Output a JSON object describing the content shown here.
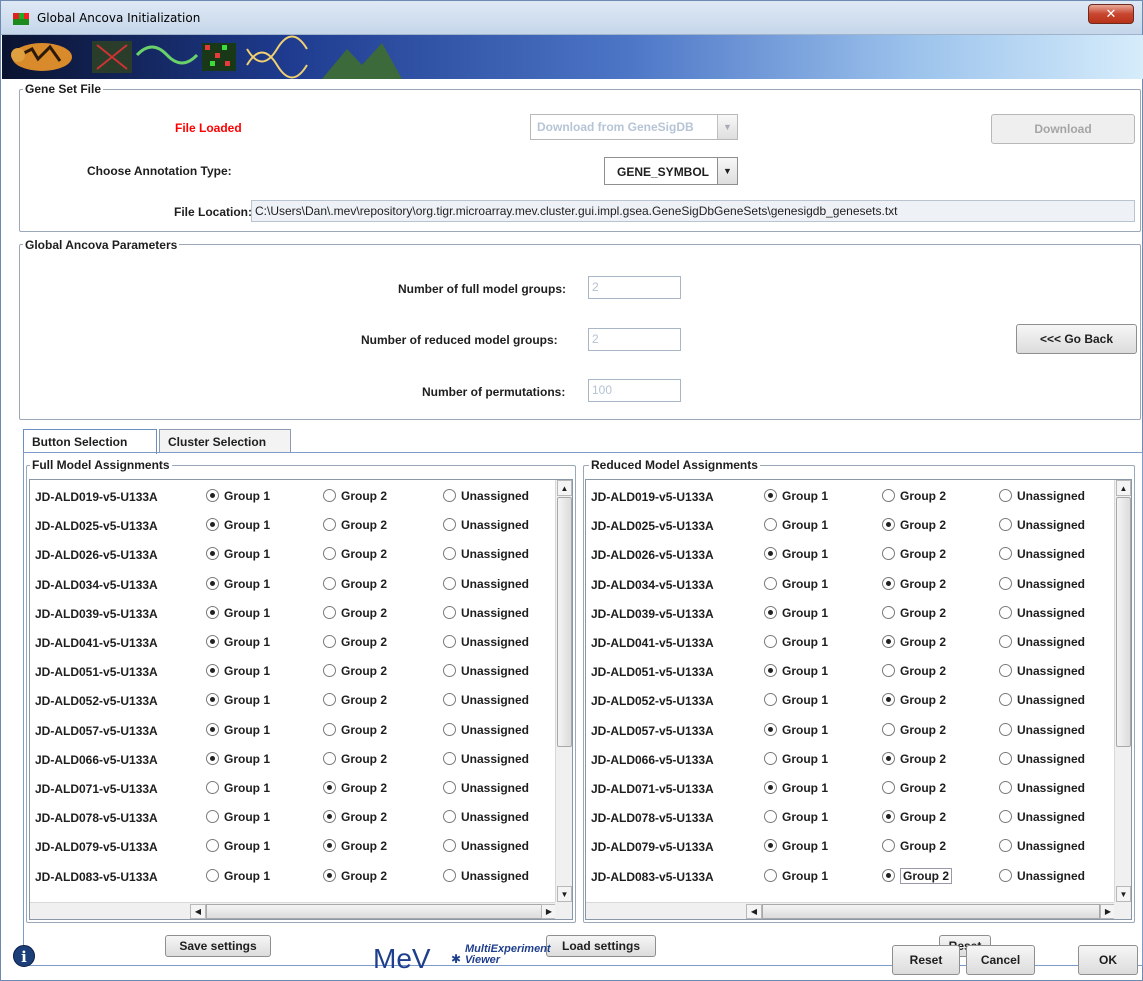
{
  "window": {
    "title": "Global Ancova Initialization",
    "close_glyph": "✕"
  },
  "gene_set": {
    "group_title": "Gene Set File",
    "status": "File Loaded",
    "status_color": "#ff0000",
    "download_combo": "Download from GeneSigDB",
    "download_button": "Download",
    "annotation_label": "Choose Annotation Type:",
    "annotation_value": "GENE_SYMBOL",
    "location_label": "File Location:",
    "location_value": "C:\\Users\\Dan\\.mev\\repository\\org.tigr.microarray.mev.cluster.gui.impl.gsea.GeneSigDbGeneSets\\genesigdb_genesets.txt"
  },
  "params": {
    "group_title": "Global Ancova Parameters",
    "full_groups_label": "Number of full model groups:",
    "full_groups_value": "2",
    "reduced_groups_label": "Number of reduced model groups:",
    "reduced_groups_value": "2",
    "permutations_label": "Number of permutations:",
    "permutations_value": "100",
    "go_back": "<<< Go Back"
  },
  "tabs": [
    "Button Selection",
    "Cluster Selection"
  ],
  "options": [
    "Group 1",
    "Group 2",
    "Unassigned"
  ],
  "full_model": {
    "title": "Full Model Assignments",
    "rows": [
      {
        "name": "JD-ALD019-v5-U133A",
        "selected": 0
      },
      {
        "name": "JD-ALD025-v5-U133A",
        "selected": 0
      },
      {
        "name": "JD-ALD026-v5-U133A",
        "selected": 0
      },
      {
        "name": "JD-ALD034-v5-U133A",
        "selected": 0
      },
      {
        "name": "JD-ALD039-v5-U133A",
        "selected": 0
      },
      {
        "name": "JD-ALD041-v5-U133A",
        "selected": 0
      },
      {
        "name": "JD-ALD051-v5-U133A",
        "selected": 0
      },
      {
        "name": "JD-ALD052-v5-U133A",
        "selected": 0
      },
      {
        "name": "JD-ALD057-v5-U133A",
        "selected": 0
      },
      {
        "name": "JD-ALD066-v5-U133A",
        "selected": 0
      },
      {
        "name": "JD-ALD071-v5-U133A",
        "selected": 1
      },
      {
        "name": "JD-ALD078-v5-U133A",
        "selected": 1
      },
      {
        "name": "JD-ALD079-v5-U133A",
        "selected": 1
      },
      {
        "name": "JD-ALD083-v5-U133A",
        "selected": 1
      }
    ]
  },
  "reduced_model": {
    "title": "Reduced Model Assignments",
    "rows": [
      {
        "name": "JD-ALD019-v5-U133A",
        "selected": 0
      },
      {
        "name": "JD-ALD025-v5-U133A",
        "selected": 1
      },
      {
        "name": "JD-ALD026-v5-U133A",
        "selected": 0
      },
      {
        "name": "JD-ALD034-v5-U133A",
        "selected": 1
      },
      {
        "name": "JD-ALD039-v5-U133A",
        "selected": 0
      },
      {
        "name": "JD-ALD041-v5-U133A",
        "selected": 1
      },
      {
        "name": "JD-ALD051-v5-U133A",
        "selected": 0
      },
      {
        "name": "JD-ALD052-v5-U133A",
        "selected": 1
      },
      {
        "name": "JD-ALD057-v5-U133A",
        "selected": 0
      },
      {
        "name": "JD-ALD066-v5-U133A",
        "selected": 1
      },
      {
        "name": "JD-ALD071-v5-U133A",
        "selected": 0
      },
      {
        "name": "JD-ALD078-v5-U133A",
        "selected": 1
      },
      {
        "name": "JD-ALD079-v5-U133A",
        "selected": 0
      },
      {
        "name": "JD-ALD083-v5-U133A",
        "selected": 1
      }
    ]
  },
  "panel_buttons": {
    "save": "Save settings",
    "load": "Load settings",
    "reset": "Reset"
  },
  "footer": {
    "logo_main": "MeV",
    "logo_line1": "MultiExperiment",
    "logo_line2": "Viewer",
    "reset": "Reset",
    "cancel": "Cancel",
    "ok": "OK"
  }
}
